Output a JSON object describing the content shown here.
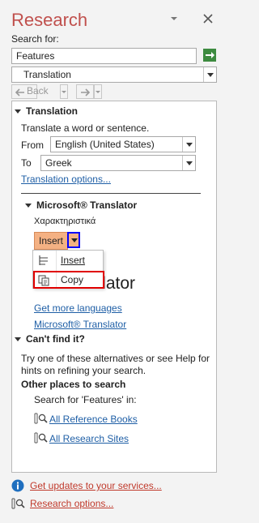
{
  "header": {
    "title": "Research",
    "dropdown_icon": "chevron-down-icon",
    "close_icon": "close-icon"
  },
  "search": {
    "label": "Search for:",
    "value": "Features"
  },
  "source": {
    "selected": "Translation"
  },
  "nav": {
    "back_label": "Back",
    "forward_label": ""
  },
  "translation": {
    "heading": "Translation",
    "description": "Translate a word or sentence.",
    "from_label": "From",
    "from_value": "English (United States)",
    "to_label": "To",
    "to_value": "Greek",
    "options_link": "Translation options..."
  },
  "translator": {
    "heading": "Microsoft® Translator",
    "result": "Χαρακτηριστικά",
    "insert_label": "Insert",
    "partial_text": "nslator",
    "more_languages": "Get more languages",
    "translator_link": "Microsoft® Translator"
  },
  "menu": {
    "insert": "Insert",
    "copy": "Copy"
  },
  "cant_find": {
    "heading": "Can't find it?",
    "help_text": "Try one of these alternatives or see Help for hints on refining your search.",
    "other_places": "Other places to search",
    "search_for": "Search for 'Features' in:",
    "all_reference_books": "All Reference Books",
    "all_research_sites": "All Research Sites"
  },
  "footer": {
    "updates": "Get updates to your services...",
    "options": "Research options..."
  },
  "colors": {
    "title": "#c0504d",
    "link": "#1f5fa6",
    "footer_link": "#c0392b",
    "insert_btn": "#f4b183",
    "copy_highlight": "#e00000",
    "arrow_highlight": "#0000ff"
  }
}
